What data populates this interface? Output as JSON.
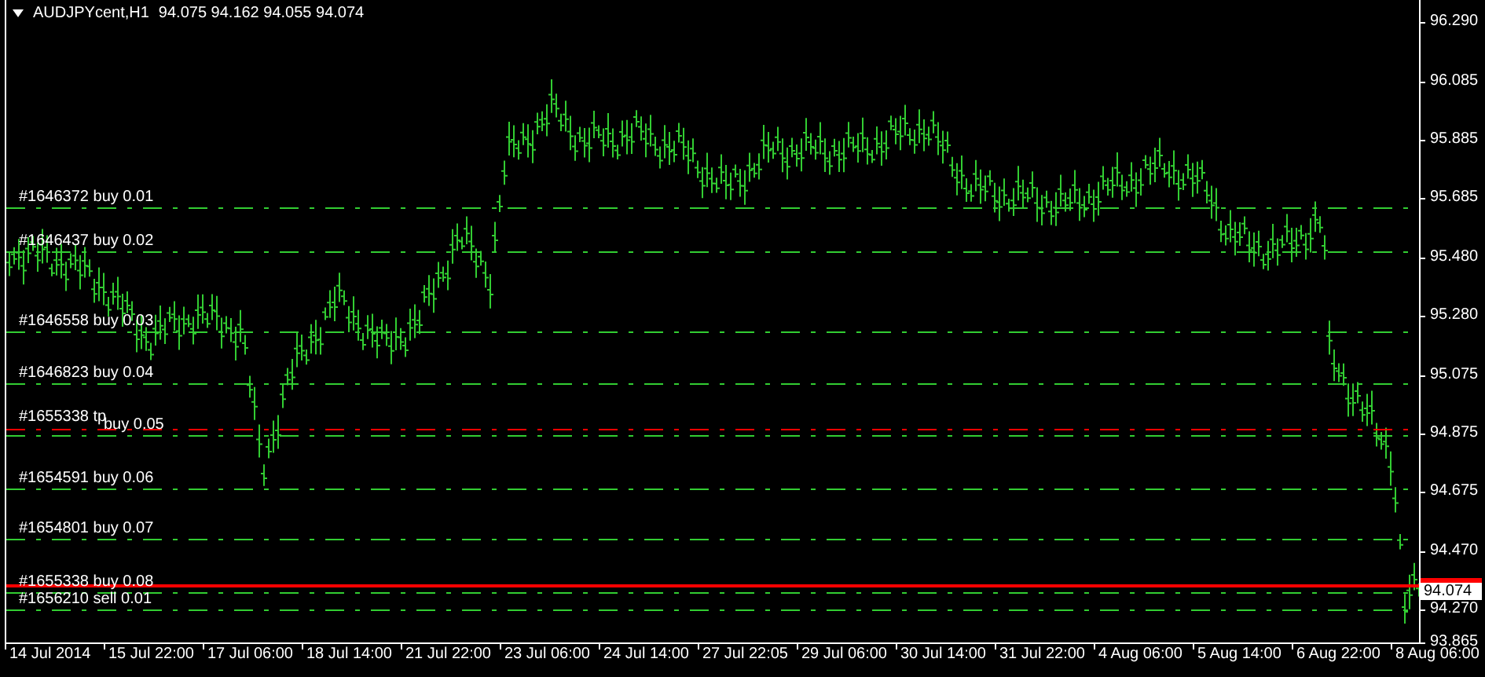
{
  "chart_header": {
    "symbol": "AUDJPYcent,H1",
    "quote": "94.075 94.162 94.055 94.074"
  },
  "order_lines": [
    {
      "kind": "order",
      "label": "#1646372 buy 0.01"
    },
    {
      "kind": "order",
      "label": "#1646437 buy 0.02"
    },
    {
      "kind": "order",
      "label": "#1646558 buy 0.03"
    },
    {
      "kind": "order",
      "label": "#1646823 buy 0.04"
    },
    {
      "kind": "take_profit",
      "label": "#1655338 tp"
    },
    {
      "kind": "order",
      "label": "buy 0.05"
    },
    {
      "kind": "order",
      "label": "#1654591 buy 0.06"
    },
    {
      "kind": "order",
      "label": "#1654801 buy 0.07"
    },
    {
      "kind": "order",
      "label": "#1655338 buy 0.08"
    },
    {
      "kind": "order",
      "label": "#1656210 sell 0.01"
    }
  ],
  "current_price": {
    "label": "94.074"
  },
  "price_axis": {
    "ticks": [
      "96.290",
      "96.085",
      "95.885",
      "95.685",
      "95.480",
      "95.280",
      "95.075",
      "94.875",
      "94.675",
      "94.470",
      "94.270",
      "93.865"
    ]
  },
  "time_axis": {
    "ticks": [
      "14 Jul 2014",
      "15 Jul 22:00",
      "17 Jul 06:00",
      "18 Jul 14:00",
      "21 Jul 22:00",
      "23 Jul 06:00",
      "24 Jul 14:00",
      "27 Jul 22:05",
      "29 Jul 06:00",
      "30 Jul 14:00",
      "31 Jul 22:00",
      "4 Aug 06:00",
      "5 Aug 14:00",
      "6 Aug 22:00",
      "8 Aug 06:00"
    ]
  }
}
